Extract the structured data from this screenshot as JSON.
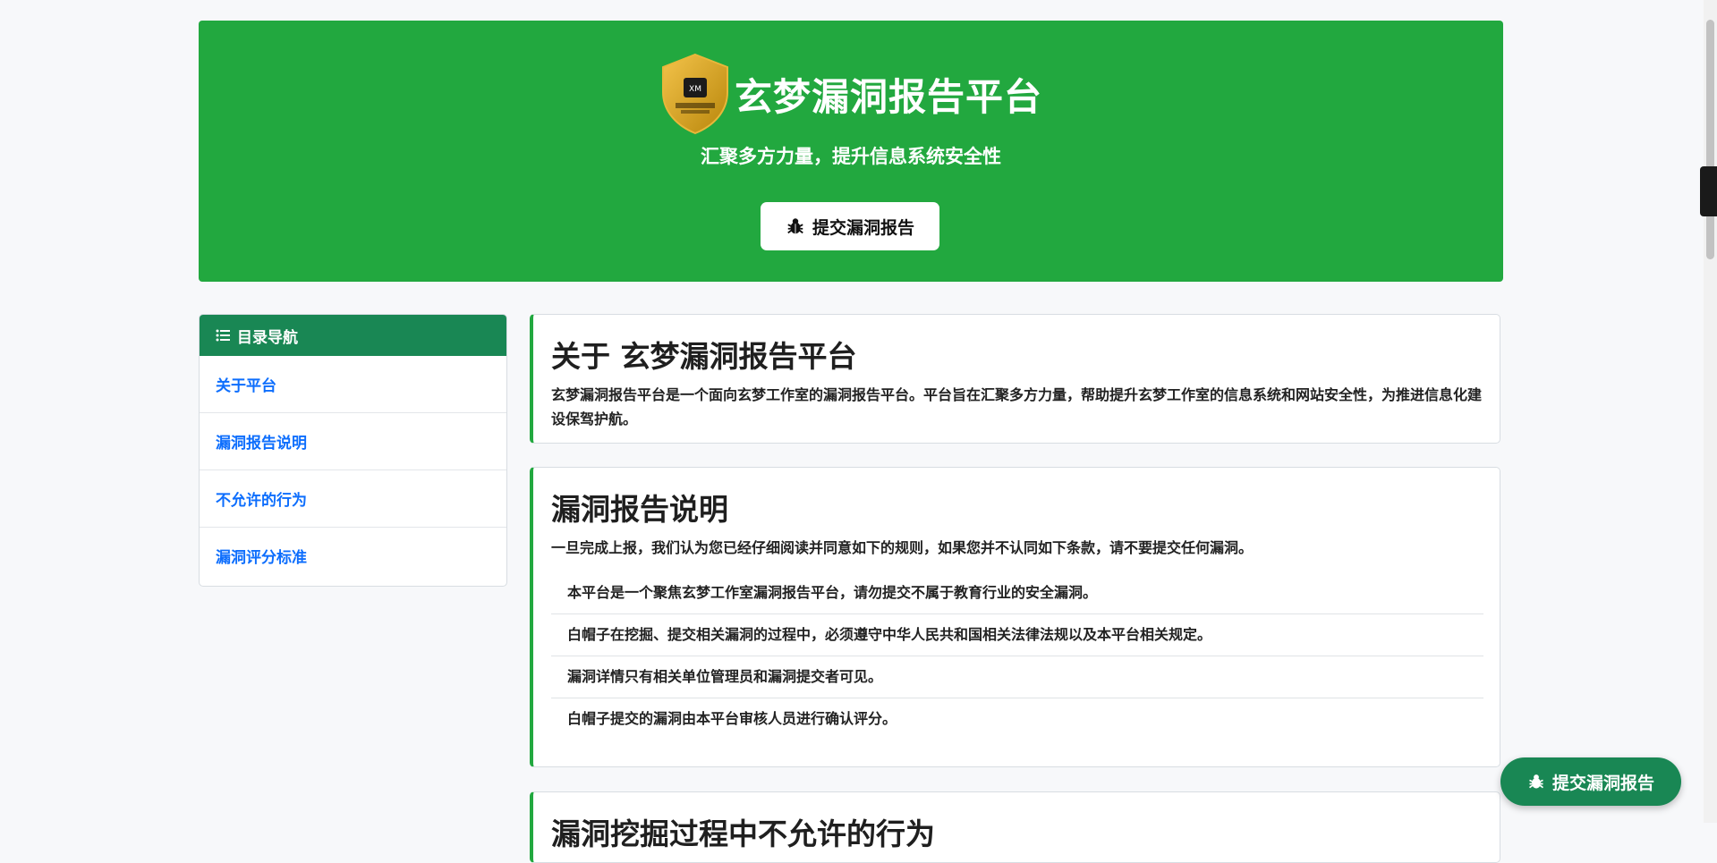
{
  "hero": {
    "title": "玄梦漏洞报告平台",
    "subtitle": "汇聚多方力量，提升信息系统安全性",
    "submit_button": "提交漏洞报告",
    "logo_icon": "shield-logo-icon"
  },
  "sidebar": {
    "header": "目录导航",
    "items": [
      {
        "label": "关于平台"
      },
      {
        "label": "漏洞报告说明"
      },
      {
        "label": "不允许的行为"
      },
      {
        "label": "漏洞评分标准"
      }
    ]
  },
  "about": {
    "title": "关于 玄梦漏洞报告平台",
    "text": "玄梦漏洞报告平台是一个面向玄梦工作室的漏洞报告平台。平台旨在汇聚多方力量，帮助提升玄梦工作室的信息系统和网站安全性，为推进信息化建设保驾护航。"
  },
  "report_guide": {
    "title": "漏洞报告说明",
    "intro": "一旦完成上报，我们认为您已经仔细阅读并同意如下的规则，如果您并不认同如下条款，请不要提交任何漏洞。",
    "rules": [
      "本平台是一个聚焦玄梦工作室漏洞报告平台，请勿提交不属于教育行业的安全漏洞。",
      "白帽子在挖掘、提交相关漏洞的过程中，必须遵守中华人民共和国相关法律法规以及本平台相关规定。",
      "漏洞详情只有相关单位管理员和漏洞提交者可见。",
      "白帽子提交的漏洞由本平台审核人员进行确认评分。"
    ]
  },
  "next_section": {
    "title": "漏洞挖掘过程中不允许的行为"
  },
  "floating_button": {
    "label": "提交漏洞报告"
  },
  "colors": {
    "hero_green": "#22a83f",
    "header_green": "#198754",
    "link_blue": "#0d6efd"
  }
}
